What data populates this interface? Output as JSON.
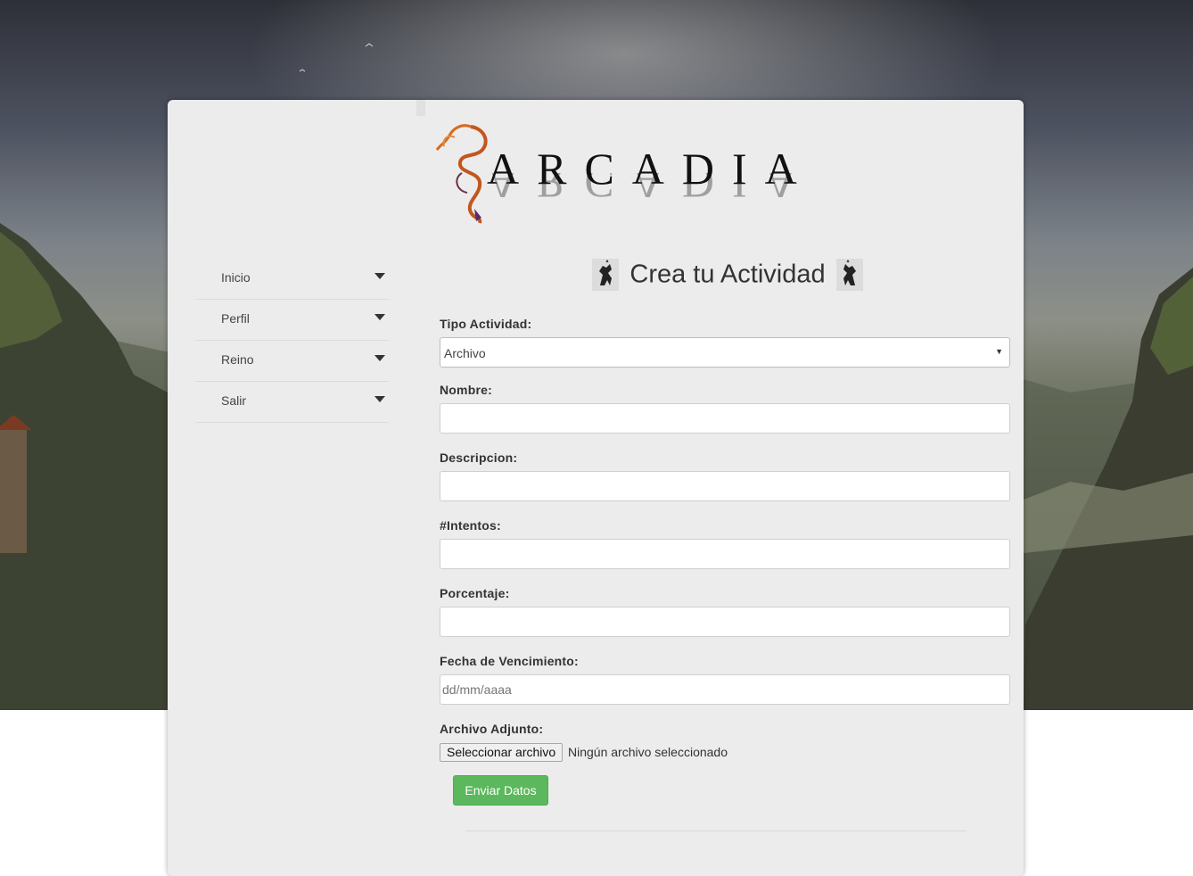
{
  "brand": {
    "name": "ARCADIA"
  },
  "sidebar": {
    "items": [
      {
        "label": "Inicio"
      },
      {
        "label": "Perfil"
      },
      {
        "label": "Reino"
      },
      {
        "label": "Salir"
      }
    ]
  },
  "form": {
    "title": "Crea tu Actividad",
    "tipo": {
      "label": "Tipo Actividad:",
      "value": "Archivo"
    },
    "nombre": {
      "label": "Nombre:",
      "value": ""
    },
    "descripcion": {
      "label": "Descripcion:",
      "value": ""
    },
    "intentos": {
      "label": "#Intentos:",
      "value": ""
    },
    "porcentaje": {
      "label": "Porcentaje:",
      "value": ""
    },
    "fecha": {
      "label": "Fecha de Vencimiento:",
      "placeholder": "dd/mm/aaaa"
    },
    "archivo": {
      "label": "Archivo Adjunto:",
      "button_label": "Seleccionar archivo",
      "status": "Ningún archivo seleccionado"
    },
    "submit_label": "Enviar Datos"
  },
  "colors": {
    "panel": "#ececec",
    "submit": "#5cb85c",
    "logo_dragon": "#c2571e"
  }
}
